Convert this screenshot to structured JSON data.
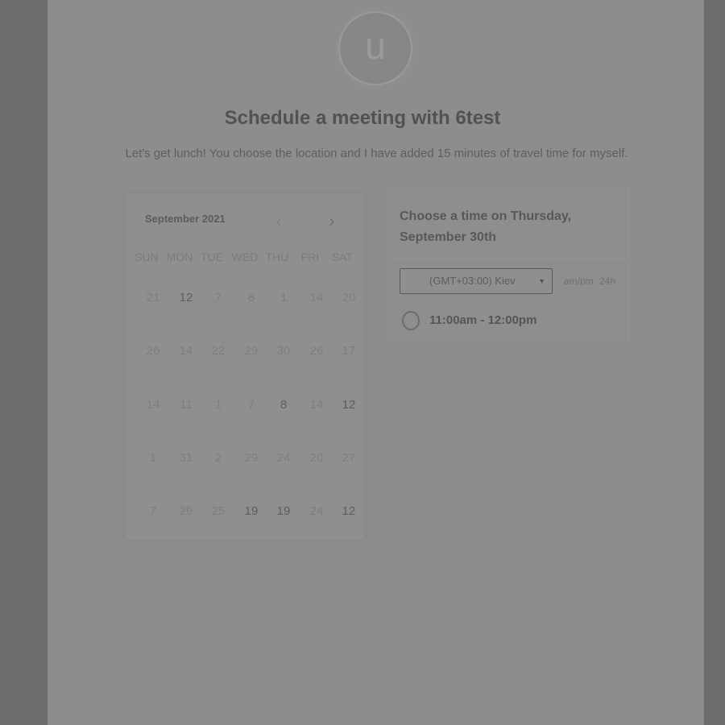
{
  "avatar": {
    "initial": "u"
  },
  "header": {
    "title": "Schedule a meeting with 6test",
    "subtitle": "Let's get lunch! You choose the location and I have added 15 minutes of travel time for myself."
  },
  "calendar": {
    "month_label": "September 2021",
    "weekdays": [
      "SUN",
      "MON",
      "TUE",
      "WED",
      "THU",
      "FRI",
      "SAT"
    ],
    "weeks": [
      [
        {
          "d": "21",
          "a": false
        },
        {
          "d": "12",
          "a": true
        },
        {
          "d": "7",
          "a": false
        },
        {
          "d": "8",
          "a": false
        },
        {
          "d": "1",
          "a": false
        },
        {
          "d": "14",
          "a": false
        },
        {
          "d": "20",
          "a": false
        }
      ],
      [
        {
          "d": "26",
          "a": false
        },
        {
          "d": "14",
          "a": false
        },
        {
          "d": "22",
          "a": false
        },
        {
          "d": "29",
          "a": false
        },
        {
          "d": "30",
          "a": false
        },
        {
          "d": "26",
          "a": false
        },
        {
          "d": "17",
          "a": false
        }
      ],
      [
        {
          "d": "14",
          "a": false
        },
        {
          "d": "11",
          "a": false
        },
        {
          "d": "1",
          "a": false
        },
        {
          "d": "7",
          "a": false
        },
        {
          "d": "8",
          "a": true
        },
        {
          "d": "14",
          "a": false
        },
        {
          "d": "12",
          "a": true
        }
      ],
      [
        {
          "d": "1",
          "a": false
        },
        {
          "d": "31",
          "a": false
        },
        {
          "d": "2",
          "a": false
        },
        {
          "d": "29",
          "a": false
        },
        {
          "d": "24",
          "a": false
        },
        {
          "d": "20",
          "a": false
        },
        {
          "d": "27",
          "a": false
        }
      ],
      [
        {
          "d": "7",
          "a": false
        },
        {
          "d": "29",
          "a": false
        },
        {
          "d": "25",
          "a": false
        },
        {
          "d": "19",
          "a": true
        },
        {
          "d": "19",
          "a": true
        },
        {
          "d": "24",
          "a": false
        },
        {
          "d": "12",
          "a": true
        }
      ]
    ]
  },
  "time_panel": {
    "heading": "Choose a time on Thursday, September 30th",
    "timezone": "(GMT+03:00) Kiev",
    "format_ampm": "am/pm",
    "format_24h": "24h",
    "slots": [
      {
        "label": "11:00am - 12:00pm"
      }
    ]
  },
  "colors": {
    "overlay_bg": "#6d6d6d",
    "page_bg": "#8d8d8d",
    "text_dark": "#525252"
  }
}
